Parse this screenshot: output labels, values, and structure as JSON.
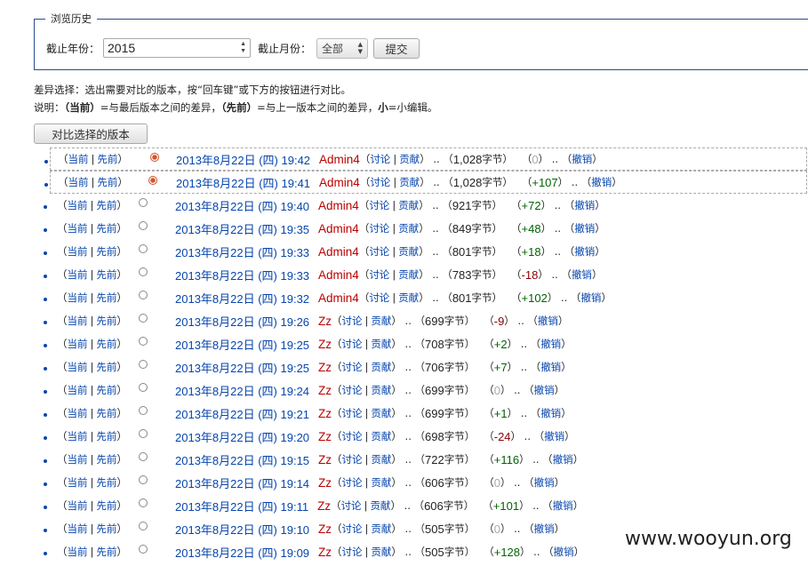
{
  "browse": {
    "legend": "浏览历史",
    "year_label": "截止年份：",
    "year_value": "2015",
    "month_label": "截止月份：",
    "month_value": "全部",
    "submit": "提交"
  },
  "info": {
    "line1": "差异选择：选出需要对比的版本，按“回车键”或下方的按钮进行对比。",
    "line2_a": "说明：",
    "line2_b": "（当前）",
    "line2_c": "=与最后版本之间的差异，",
    "line2_d": "（先前）",
    "line2_e": "=与上一版本之间的差异，",
    "line2_f": "小",
    "line2_g": "=小编辑。"
  },
  "compare_button": "对比选择的版本",
  "labels": {
    "cur": "当前",
    "prev": "先前",
    "talk": "讨论",
    "contrib": "贡献",
    "undo": "撤销",
    "dots": "..",
    "bytes_suffix": "字节"
  },
  "revisions": [
    {
      "date": "2013年8月22日 (四) 19:42",
      "user": "Admin4",
      "size": "1,028",
      "diff": "0",
      "sign": "zero",
      "radio": "on"
    },
    {
      "date": "2013年8月22日 (四) 19:41",
      "user": "Admin4",
      "size": "1,028",
      "diff": "+107",
      "sign": "pos",
      "radio": "on"
    },
    {
      "date": "2013年8月22日 (四) 19:40",
      "user": "Admin4",
      "size": "921",
      "diff": "+72",
      "sign": "pos",
      "radio": "off"
    },
    {
      "date": "2013年8月22日 (四) 19:35",
      "user": "Admin4",
      "size": "849",
      "diff": "+48",
      "sign": "pos",
      "radio": "off"
    },
    {
      "date": "2013年8月22日 (四) 19:33",
      "user": "Admin4",
      "size": "801",
      "diff": "+18",
      "sign": "pos",
      "radio": "off"
    },
    {
      "date": "2013年8月22日 (四) 19:33",
      "user": "Admin4",
      "size": "783",
      "diff": "-18",
      "sign": "neg",
      "radio": "off"
    },
    {
      "date": "2013年8月22日 (四) 19:32",
      "user": "Admin4",
      "size": "801",
      "diff": "+102",
      "sign": "pos",
      "radio": "off"
    },
    {
      "date": "2013年8月22日 (四) 19:26",
      "user": "Zz",
      "size": "699",
      "diff": "-9",
      "sign": "neg",
      "radio": "off"
    },
    {
      "date": "2013年8月22日 (四) 19:25",
      "user": "Zz",
      "size": "708",
      "diff": "+2",
      "sign": "pos",
      "radio": "off"
    },
    {
      "date": "2013年8月22日 (四) 19:25",
      "user": "Zz",
      "size": "706",
      "diff": "+7",
      "sign": "pos",
      "radio": "off"
    },
    {
      "date": "2013年8月22日 (四) 19:24",
      "user": "Zz",
      "size": "699",
      "diff": "0",
      "sign": "zero",
      "radio": "off"
    },
    {
      "date": "2013年8月22日 (四) 19:21",
      "user": "Zz",
      "size": "699",
      "diff": "+1",
      "sign": "pos",
      "radio": "off"
    },
    {
      "date": "2013年8月22日 (四) 19:20",
      "user": "Zz",
      "size": "698",
      "diff": "-24",
      "sign": "neg",
      "radio": "off"
    },
    {
      "date": "2013年8月22日 (四) 19:15",
      "user": "Zz",
      "size": "722",
      "diff": "+116",
      "sign": "pos",
      "radio": "off"
    },
    {
      "date": "2013年8月22日 (四) 19:14",
      "user": "Zz",
      "size": "606",
      "diff": "0",
      "sign": "zero",
      "radio": "off"
    },
    {
      "date": "2013年8月22日 (四) 19:11",
      "user": "Zz",
      "size": "606",
      "diff": "+101",
      "sign": "pos",
      "radio": "off"
    },
    {
      "date": "2013年8月22日 (四) 19:10",
      "user": "Zz",
      "size": "505",
      "diff": "0",
      "sign": "zero",
      "radio": "off"
    },
    {
      "date": "2013年8月22日 (四) 19:09",
      "user": "Zz",
      "size": "505",
      "diff": "+128",
      "sign": "pos",
      "radio": "off"
    }
  ],
  "watermark": "www.wooyun.org"
}
